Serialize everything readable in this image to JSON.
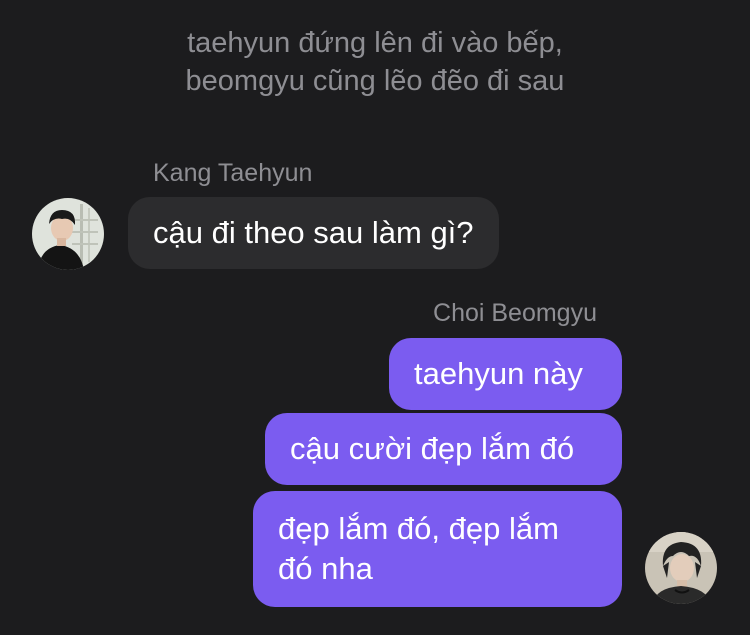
{
  "narration": {
    "line1": "taehyun đứng lên đi vào bếp,",
    "line2": "beomgyu cũng lẽo đẽo đi sau"
  },
  "incoming": {
    "sender": "Kang Taehyun",
    "avatar_icon": "profile-photo-taehyun",
    "messages": [
      "cậu đi theo sau làm gì?"
    ]
  },
  "outgoing": {
    "sender": "Choi Beomgyu",
    "avatar_icon": "profile-photo-beomgyu",
    "messages": [
      "taehyun này",
      "cậu cười đẹp lắm đó",
      "đẹp lắm đó, đẹp lắm đó nha"
    ],
    "last_message_lines": [
      "đẹp lắm đó, đẹp lắm",
      "đó nha"
    ]
  },
  "colors": {
    "background": "#1c1c1e",
    "incoming_bubble": "#2c2c2e",
    "outgoing_bubble": "#7b5cf0",
    "meta_text": "#8e8e93",
    "message_text": "#ffffff"
  }
}
